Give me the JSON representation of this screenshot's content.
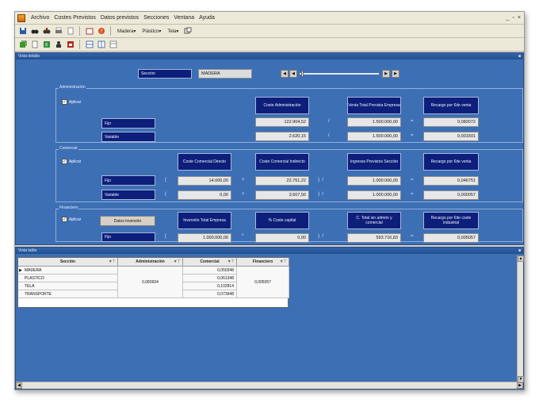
{
  "menu": {
    "items": [
      "Archivo",
      "Costes Previstos",
      "Datos previstos",
      "Secciones",
      "Ventana",
      "Ayuda"
    ],
    "controls": [
      "_",
      "×"
    ]
  },
  "toolbar1": {
    "dropdowns": [
      "Madera",
      "Plástico",
      "Tela"
    ]
  },
  "panel_top": {
    "title": "Vista detalle",
    "section_label": "Sección",
    "section_value": "MADERA"
  },
  "admin": {
    "group_label": "Administración",
    "apply_label": "Aplicar",
    "fijo_label": "Fijo",
    "variable_label": "Variable",
    "header_coste": "Coste Administración",
    "header_ventas": "Venta Total Prevista Empresa",
    "header_recargo": "Recargo por €de venta",
    "coste_fijo": "122.904,52",
    "coste_variable": "2.620,15",
    "ventas_fijo": "1.500.000,00",
    "ventas_variable": "1.500.000,00",
    "recargo_fijo": "0,082072",
    "recargo_variable": "0,001501"
  },
  "comercial": {
    "group_label": "Comercial",
    "apply_label": "Aplicar",
    "fijo_label": "Fijo",
    "variable_label": "Variable",
    "header_directo": "Coste Comercial Directo",
    "header_indirecto": "Coste Comercial Indirecto",
    "header_ingresos": "Ingresos Previstos Sección",
    "header_recargo": "Recargo por €de venta",
    "directo_fijo": "14.000,00",
    "directo_variable": "0,00",
    "indirecto_fijo": "22.751,22",
    "indirecto_variable": "3.507,50",
    "ingresos_fijo": "1.000.000,00",
    "ingresos_variable": "1.000.000,00",
    "recargo_fijo": "0,046751",
    "recargo_variable": "0,000057"
  },
  "financiero": {
    "group_label": "Financiero",
    "apply_label": "Aplicar",
    "button_label": "Datos inversión",
    "fijo_label": "Fijo",
    "header_inversion": "Inversión Total Empresa",
    "header_coste_capital": "% Coste capital",
    "header_total_ventas": "C. Total sin admón y comercial",
    "header_recargo": "Recargo por €de coste industrial",
    "inversion_fijo": "1.000.000,00",
    "coste_capital_fijo": "0,00",
    "total_ventas_fijo": "593.716,83",
    "recargo_fijo": "0,005057"
  },
  "panel_bottom": {
    "title": "Vista tabla",
    "columns": [
      "Sección",
      "Administración",
      "Comercial",
      "Financiero"
    ],
    "rows": [
      {
        "seccion": "MADERA",
        "comercial": "0,050348"
      },
      {
        "seccion": "PLASTICO",
        "comercial": "0,061348"
      },
      {
        "seccion": "TELA",
        "comercial": "0,102814"
      },
      {
        "seccion": "TRANSPORTE",
        "comercial": "0,073948"
      }
    ],
    "administracion_merged": "0,083604",
    "financiero_merged": "0,005057"
  }
}
